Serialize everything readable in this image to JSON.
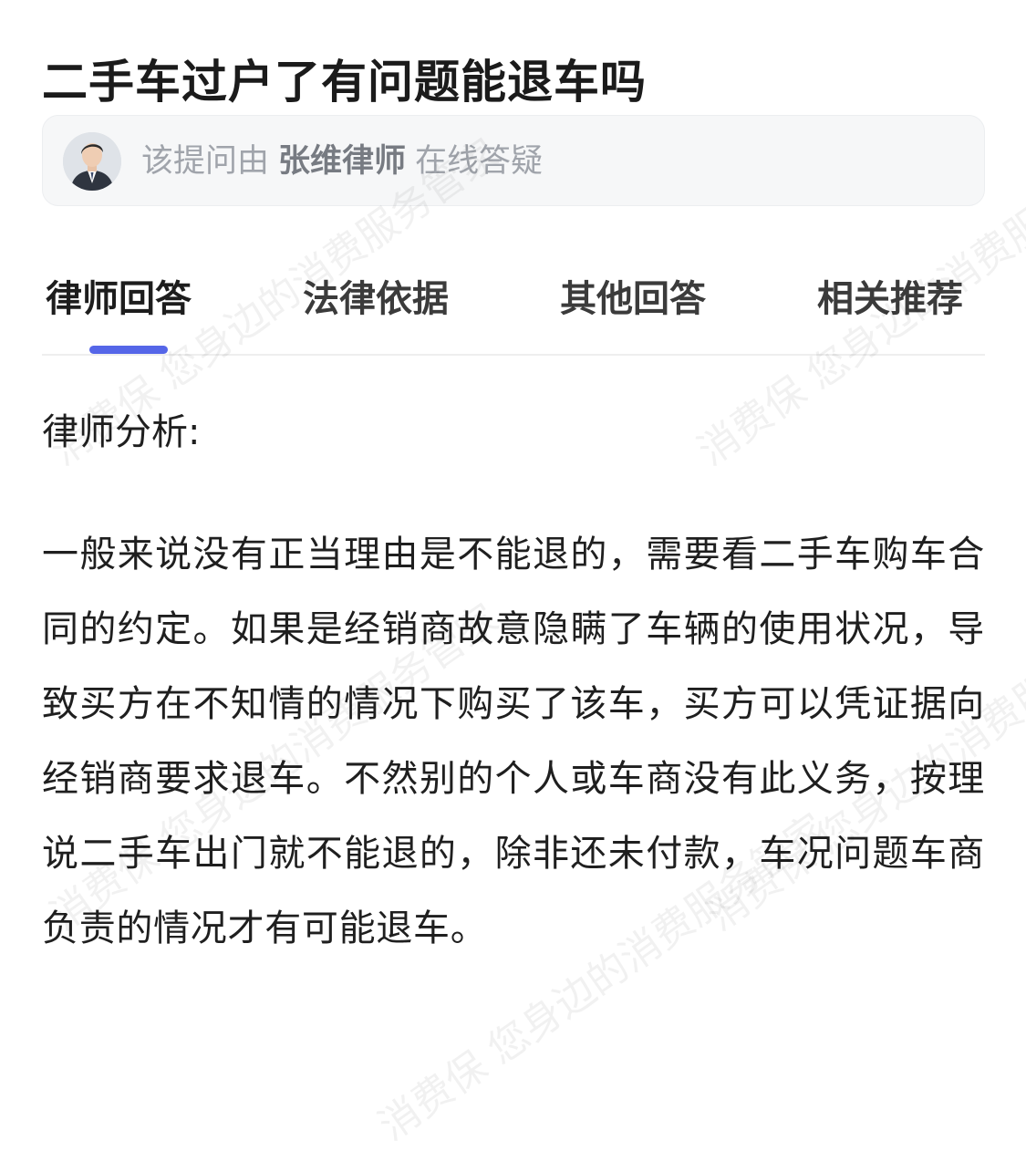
{
  "question": {
    "title": "二手车过户了有问题能退车吗"
  },
  "answerer": {
    "prefix": "该提问由",
    "name": "张维律师",
    "suffix": "在线答疑",
    "avatar_icon": "person-avatar-icon"
  },
  "tabs": [
    {
      "label": "律师回答",
      "active": true
    },
    {
      "label": "法律依据",
      "active": false
    },
    {
      "label": "其他回答",
      "active": false
    },
    {
      "label": "相关推荐",
      "active": false
    }
  ],
  "answer": {
    "section_label": "律师分析:",
    "body": "一般来说没有正当理由是不能退的，需要看二手车购车合同的约定。如果是经销商故意隐瞒了车辆的使用状况，导致买方在不知情的情况下购买了该车，买方可以凭证据向经销商要求退车。不然别的个人或车商没有此义务，按理说二手车出门就不能退的，除非还未付款，车况问题车商负责的情况才有可能退车。"
  },
  "watermark": {
    "text": "消费保 您身边的消费服务管家"
  },
  "colors": {
    "accent": "#5566e8",
    "card_background": "#f6f7f8",
    "muted_text": "#a0a4ab"
  }
}
